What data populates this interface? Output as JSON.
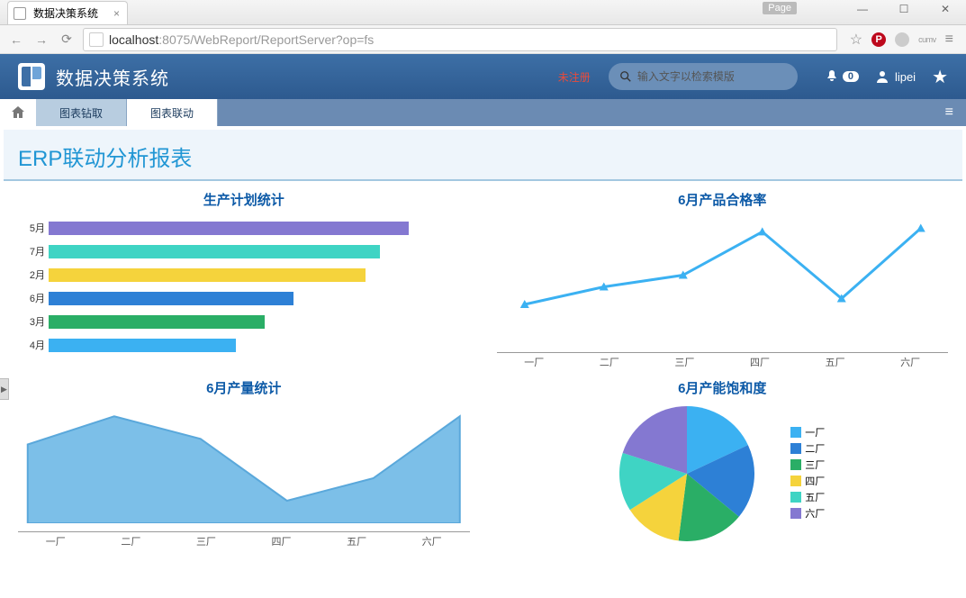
{
  "browser": {
    "tab_title": "数据决策系统",
    "page_badge": "Page",
    "url_host": "localhost",
    "url_port_path": ":8075/WebReport/ReportServer?op=fs",
    "window_controls": {
      "min": "—",
      "max": "☐",
      "close": "✕"
    }
  },
  "header": {
    "title": "数据决策系统",
    "unregistered": "未注册",
    "search_placeholder": "输入文字以检索模版",
    "notification_count": "0",
    "username": "lipei"
  },
  "tabs": {
    "home_icon": "home",
    "items": [
      {
        "label": "图表钻取",
        "active": false
      },
      {
        "label": "图表联动",
        "active": true
      }
    ]
  },
  "page_title": "ERP联动分析报表",
  "charts": {
    "plan": {
      "title": "生产计划统计"
    },
    "pass": {
      "title": "6月产品合格率"
    },
    "output": {
      "title": "6月产量统计"
    },
    "capacity": {
      "title": "6月产能饱和度"
    }
  },
  "chart_data": [
    {
      "id": "plan",
      "type": "bar",
      "orientation": "horizontal",
      "title": "生产计划统计",
      "categories": [
        "5月",
        "7月",
        "2月",
        "6月",
        "3月",
        "4月"
      ],
      "values": [
        100,
        92,
        88,
        68,
        60,
        52
      ],
      "colors": [
        "#8478d1",
        "#3fd4c4",
        "#f5d33c",
        "#2d80d6",
        "#2aae66",
        "#3bb1f2"
      ]
    },
    {
      "id": "pass",
      "type": "line",
      "title": "6月产品合格率",
      "categories": [
        "一厂",
        "二厂",
        "三厂",
        "四厂",
        "五厂",
        "六厂"
      ],
      "values": [
        30,
        45,
        55,
        92,
        35,
        95
      ],
      "ylim": [
        0,
        100
      ],
      "color": "#3bb1f2"
    },
    {
      "id": "output",
      "type": "area",
      "title": "6月产量统计",
      "categories": [
        "一厂",
        "二厂",
        "三厂",
        "四厂",
        "五厂",
        "六厂"
      ],
      "values": [
        70,
        95,
        75,
        20,
        40,
        95
      ],
      "ylim": [
        0,
        100
      ],
      "color": "#7cbfe8"
    },
    {
      "id": "capacity",
      "type": "pie",
      "title": "6月产能饱和度",
      "series": [
        {
          "name": "一厂",
          "value": 18,
          "color": "#3bb1f2"
        },
        {
          "name": "二厂",
          "value": 18,
          "color": "#2d80d6"
        },
        {
          "name": "三厂",
          "value": 16,
          "color": "#2aae66"
        },
        {
          "name": "四厂",
          "value": 14,
          "color": "#f5d33c"
        },
        {
          "name": "五厂",
          "value": 14,
          "color": "#3fd4c4"
        },
        {
          "name": "六厂",
          "value": 20,
          "color": "#8478d1"
        }
      ]
    }
  ]
}
